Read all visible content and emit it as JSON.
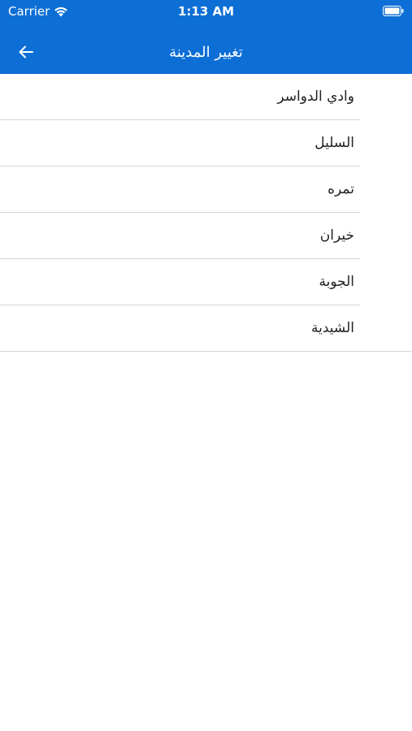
{
  "status_bar": {
    "carrier": "Carrier",
    "time": "1:13 AM"
  },
  "header": {
    "title": "تغيير المدينة",
    "back_icon": "arrow-left-icon",
    "background_color": "#0d6fd6"
  },
  "cities": [
    {
      "label": "وادي الدواسر"
    },
    {
      "label": "السليل"
    },
    {
      "label": "تمره"
    },
    {
      "label": "خيران"
    },
    {
      "label": "الجوبة"
    },
    {
      "label": "الشيدية"
    }
  ]
}
